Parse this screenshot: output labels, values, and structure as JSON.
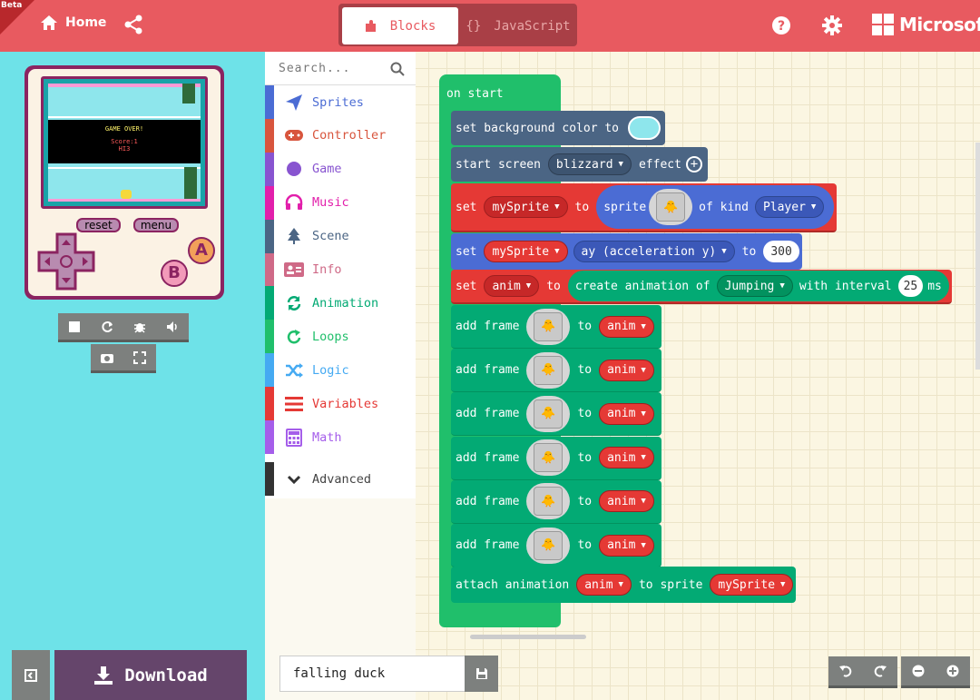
{
  "header": {
    "beta": "Beta",
    "home_label": "Home",
    "tabs": {
      "blocks": "Blocks",
      "javascript": "JavaScript"
    },
    "brand": "Microsoft",
    "colors": {
      "bar": "#e85a60",
      "toggle": "#a93f46"
    }
  },
  "simulator": {
    "game_over": "GAME OVER!",
    "score": "Score:1",
    "hi": "HI3",
    "reset_label": "reset",
    "menu_label": "menu",
    "a_label": "A",
    "b_label": "B",
    "download_label": "Download",
    "colors": {
      "panel": "#6ee2e8",
      "device": "#8b2461",
      "download": "#65456b"
    }
  },
  "toolbox": {
    "search_placeholder": "Search...",
    "categories": [
      {
        "label": "Sprites",
        "color": "#4b6cd4",
        "icon": "paper-plane-icon"
      },
      {
        "label": "Controller",
        "color": "#d8553d",
        "icon": "gamepad-icon"
      },
      {
        "label": "Game",
        "color": "#8854d0",
        "icon": "circle-icon"
      },
      {
        "label": "Music",
        "color": "#e21fab",
        "icon": "headphones-icon"
      },
      {
        "label": "Scene",
        "color": "#4b6584",
        "icon": "tree-icon"
      },
      {
        "label": "Info",
        "color": "#cf6a87",
        "icon": "id-card-icon"
      },
      {
        "label": "Animation",
        "color": "#03aa74",
        "icon": "refresh-icon"
      },
      {
        "label": "Loops",
        "color": "#20bf6b",
        "icon": "loop-icon"
      },
      {
        "label": "Logic",
        "color": "#45aaf2",
        "icon": "shuffle-icon"
      },
      {
        "label": "Variables",
        "color": "#e53935",
        "icon": "list-icon"
      },
      {
        "label": "Math",
        "color": "#a55eea",
        "icon": "calculator-icon"
      }
    ],
    "advanced_label": "Advanced"
  },
  "workspace": {
    "on_start": "on start",
    "set_bg": {
      "text": "set background color to",
      "color": "#8ee6ec"
    },
    "start_screen": {
      "text1": "start screen",
      "effect": "blizzard",
      "text2": "effect"
    },
    "set_sprite": {
      "set": "set",
      "var": "mySprite",
      "to": "to",
      "sprite": "sprite",
      "of_kind": "of kind",
      "kind": "Player"
    },
    "set_ay": {
      "set": "set",
      "var": "mySprite",
      "prop": "ay (acceleration y)",
      "to": "to",
      "value": "300"
    },
    "set_anim": {
      "set": "set",
      "var": "anim",
      "to": "to",
      "create": "create animation of",
      "type": "Jumping",
      "with_interval": "with interval",
      "interval": "25",
      "ms": "ms"
    },
    "add_frame": {
      "text": "add frame",
      "to": "to",
      "var": "anim"
    },
    "attach": {
      "text": "attach animation",
      "var": "anim",
      "to_sprite": "to sprite",
      "sprite_var": "mySprite"
    },
    "colors": {
      "loops": "#20bf6b",
      "scene": "#4b6584",
      "variables": "#e53935",
      "sprites": "#4b6cd4",
      "animation": "#03aa74"
    }
  },
  "footer": {
    "project_name": "falling duck"
  }
}
